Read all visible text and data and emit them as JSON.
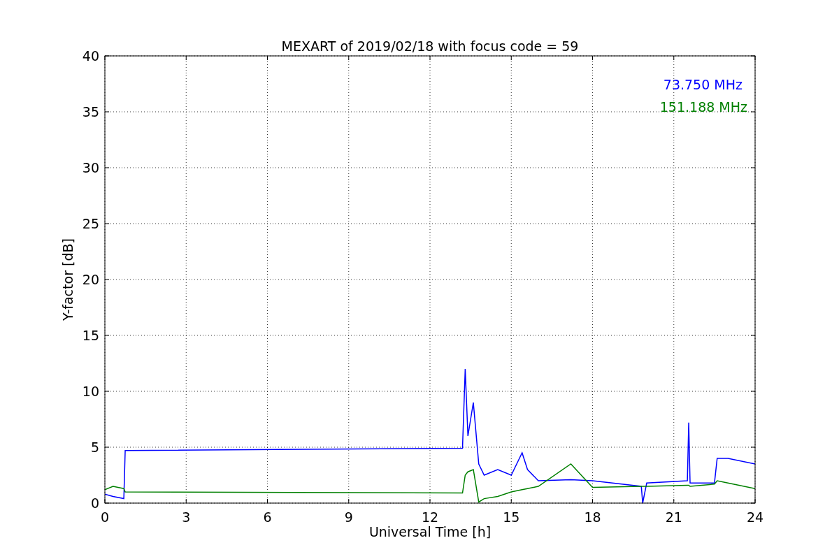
{
  "figure": {
    "chart_data": {
      "type": "line",
      "title": "MEXART of 2019/02/18 with focus code = 59",
      "xlabel": "Universal Time [h]",
      "ylabel": "Y-factor [dB]",
      "grid": true,
      "xlim": [
        0,
        24
      ],
      "ylim": [
        0,
        40
      ],
      "xticks": [
        0,
        3,
        6,
        9,
        12,
        15,
        18,
        21,
        24
      ],
      "yticks": [
        0,
        5,
        10,
        15,
        20,
        25,
        30,
        35,
        40
      ],
      "x": [
        0,
        0.3,
        0.7,
        0.75,
        13.2,
        13.3,
        13.4,
        13.6,
        13.8,
        14,
        14.5,
        15,
        15.4,
        15.6,
        16,
        17.2,
        18,
        19.8,
        19.85,
        20,
        21.5,
        21.55,
        21.6,
        22.5,
        22.6,
        23,
        24
      ],
      "series": [
        {
          "name": "73.750 MHz",
          "color": "#0000ff",
          "values": [
            0.8,
            0.6,
            0.4,
            4.7,
            4.9,
            12,
            6,
            9,
            3.5,
            2.5,
            3,
            2.5,
            4.5,
            3,
            2,
            2.1,
            2,
            1.5,
            0,
            1.8,
            2,
            7.2,
            1.8,
            1.8,
            4,
            4,
            3.5
          ]
        },
        {
          "name": "151.188 MHz",
          "color": "#008000",
          "values": [
            1.2,
            1.5,
            1.3,
            1,
            0.9,
            2.5,
            2.8,
            3,
            0.1,
            0.4,
            0.6,
            1,
            1.2,
            1.3,
            1.5,
            3.5,
            1.4,
            1.5,
            1.5,
            1.5,
            1.6,
            1.6,
            1.5,
            1.7,
            2,
            1.8,
            1.3
          ]
        }
      ]
    }
  }
}
